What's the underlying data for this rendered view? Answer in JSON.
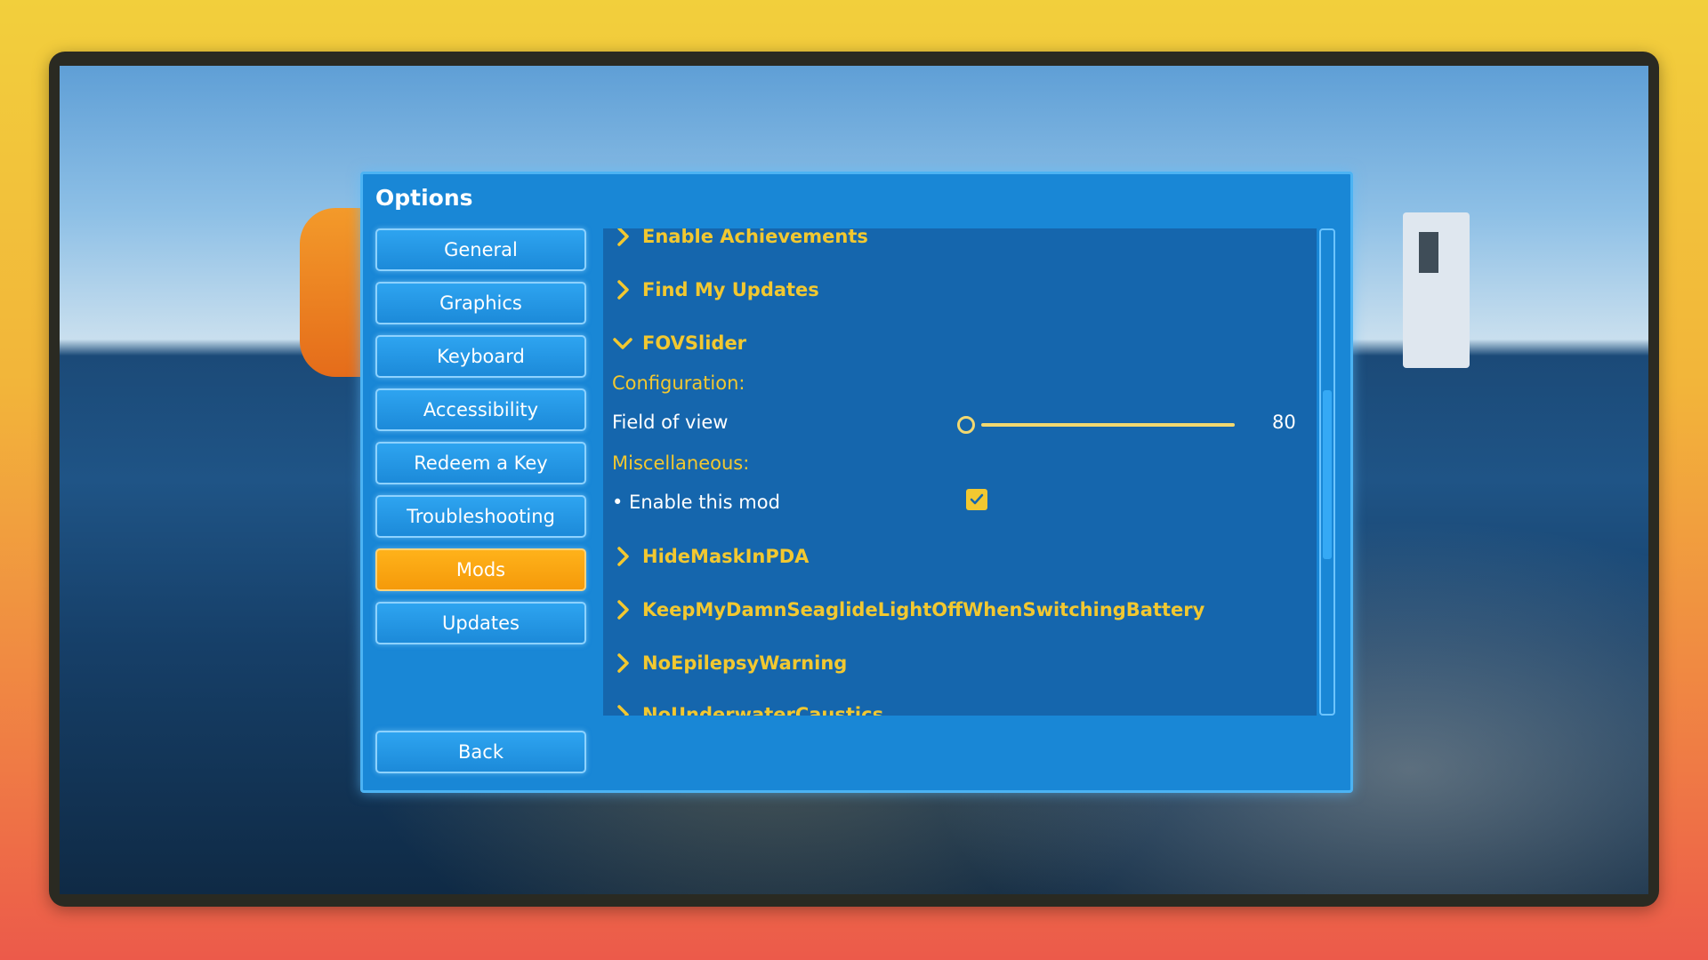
{
  "options": {
    "title": "Options",
    "nav": [
      {
        "label": "General",
        "active": false
      },
      {
        "label": "Graphics",
        "active": false
      },
      {
        "label": "Keyboard",
        "active": false
      },
      {
        "label": "Accessibility",
        "active": false
      },
      {
        "label": "Redeem a Key",
        "active": false
      },
      {
        "label": "Troubleshooting",
        "active": false
      },
      {
        "label": "Mods",
        "active": true
      },
      {
        "label": "Updates",
        "active": false
      }
    ],
    "back_label": "Back"
  },
  "mods": {
    "items": [
      {
        "name": "Enable Achievements",
        "expanded": false
      },
      {
        "name": "Find My Updates",
        "expanded": false
      },
      {
        "name": "FOVSlider",
        "expanded": true
      },
      {
        "name": "HideMaskInPDA",
        "expanded": false
      },
      {
        "name": "KeepMyDamnSeaglideLightOffWhenSwitchingBattery",
        "expanded": false
      },
      {
        "name": "NoEpilepsyWarning",
        "expanded": false
      },
      {
        "name": "NoUnderwaterCaustics",
        "expanded": false
      }
    ],
    "fov": {
      "configuration_label": "Configuration:",
      "field_of_view_label": "Field of view",
      "field_of_view_value": "80",
      "miscellaneous_label": "Miscellaneous:",
      "enable_label": "• Enable this mod",
      "enable_checked": true
    }
  },
  "colors": {
    "panel": "#1987d6",
    "content": "#1566ad",
    "accent_yellow": "#f2c830",
    "active_orange": "#ffb21a"
  }
}
